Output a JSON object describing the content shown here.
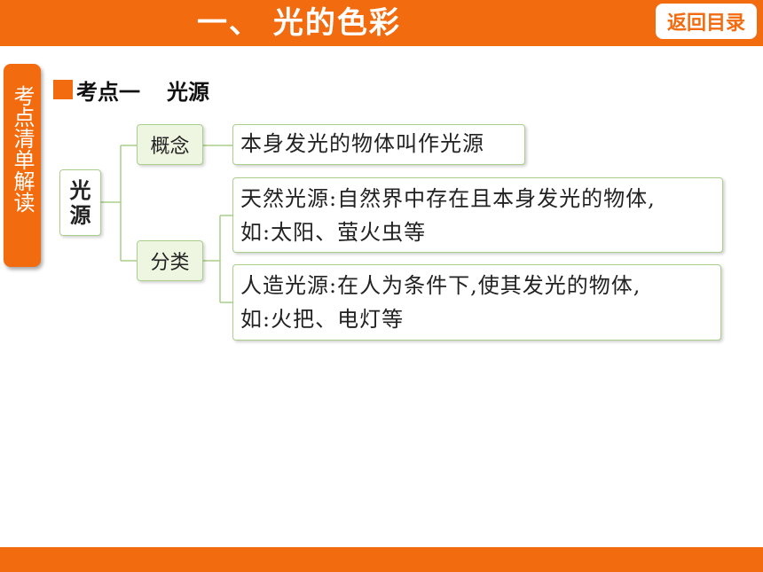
{
  "header": {
    "title": "一、 光的色彩",
    "back_label": "返回目录"
  },
  "side_tab": {
    "label": "考点清单解读"
  },
  "section": {
    "heading_prefix": "考点一",
    "heading_title": "光源"
  },
  "mindmap": {
    "root": "光源",
    "concept": {
      "label": "概念",
      "text": "本身发光的物体叫作光源"
    },
    "classification": {
      "label": "分类",
      "items": [
        {
          "line1": "天然光源:自然界中存在且本身发光的物体,",
          "line2": "如:太阳、萤火虫等"
        },
        {
          "line1": "人造光源:在人为条件下,使其发光的物体,",
          "line2": "如:火把、电灯等"
        }
      ]
    }
  },
  "colors": {
    "accent": "#f26b0f",
    "box_border": "#a9cf8a",
    "label_fill": "#eef6e1"
  }
}
